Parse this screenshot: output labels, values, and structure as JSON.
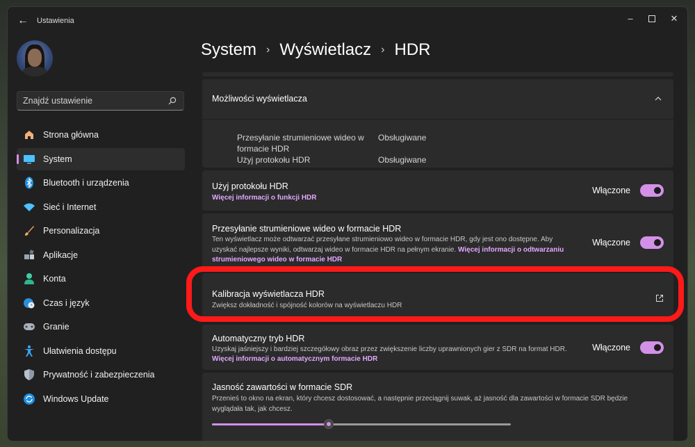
{
  "window": {
    "app_title": "Ustawienia"
  },
  "search": {
    "placeholder": "Znajdź ustawienie"
  },
  "sidebar": {
    "items": [
      {
        "label": "Strona główna",
        "icon": "home-icon"
      },
      {
        "label": "System",
        "icon": "monitor-icon",
        "active": true
      },
      {
        "label": "Bluetooth i urządzenia",
        "icon": "bluetooth-icon"
      },
      {
        "label": "Sieć i Internet",
        "icon": "wifi-icon"
      },
      {
        "label": "Personalizacja",
        "icon": "brush-icon"
      },
      {
        "label": "Aplikacje",
        "icon": "apps-icon"
      },
      {
        "label": "Konta",
        "icon": "person-icon"
      },
      {
        "label": "Czas i język",
        "icon": "clock-globe-icon"
      },
      {
        "label": "Granie",
        "icon": "gamepad-icon"
      },
      {
        "label": "Ułatwienia dostępu",
        "icon": "accessibility-icon"
      },
      {
        "label": "Prywatność i zabezpieczenia",
        "icon": "shield-icon"
      },
      {
        "label": "Windows Update",
        "icon": "update-icon"
      }
    ]
  },
  "breadcrumb": {
    "level1": "System",
    "level2": "Wyświetlacz",
    "level3": "HDR",
    "separator": "›"
  },
  "capabilities": {
    "title": "Możliwości wyświetlacza",
    "row1_label_a": "Przesyłanie strumieniowe wideo w",
    "row1_label_b": "formacie HDR",
    "row1_value": "Obsługiwane",
    "row2_label": "Użyj protokołu HDR",
    "row2_value": "Obsługiwane"
  },
  "use_hdr": {
    "title": "Użyj protokołu HDR",
    "link": "Więcej informacji o funkcji HDR",
    "state": "Włączone",
    "on": true
  },
  "streaming": {
    "title": "Przesyłanie strumieniowe wideo w formacie HDR",
    "desc_line1": "Ten wyświetlacz może odtwarzać przesyłane strumieniowo wideo w formacie HDR, gdy jest ono dostępne. Aby",
    "desc_line2": "uzyskać najlepsze wyniki, odtwarzaj wideo w formacie HDR na pełnym ekranie.",
    "link_part1": "Więcej informacji o odtwarzaniu",
    "link_part2": "strumieniowego wideo w formacie HDR",
    "state": "Włączone",
    "on": true
  },
  "calibration": {
    "title": "Kalibracja wyświetlacza HDR",
    "desc": "Zwiększ dokładność i spójność kolorów na wyświetlaczu HDR",
    "icon": "external-link-icon"
  },
  "auto_hdr": {
    "title": "Automatyczny tryb HDR",
    "desc": "Uzyskaj jaśniejszy i bardziej szczegółowy obraz przez zwiększenie liczby uprawnionych gier z SDR na format HDR.",
    "link": "Więcej informacji o automatycznym formacie HDR",
    "state": "Włączone",
    "on": true
  },
  "sdr": {
    "title": "Jasność zawartości w formacie SDR",
    "desc_line1": "Przenieś to okno na ekran, który chcesz dostosować, a następnie przeciągnij suwak, aż jasność dla zawartości w formacie SDR będzie",
    "desc_line2": "wyglądała tak, jak chcesz.",
    "slider_fraction": 0.39
  },
  "colors": {
    "accent": "#d291e6",
    "link": "#e2a9ff",
    "highlight": "#ff1a1a"
  }
}
